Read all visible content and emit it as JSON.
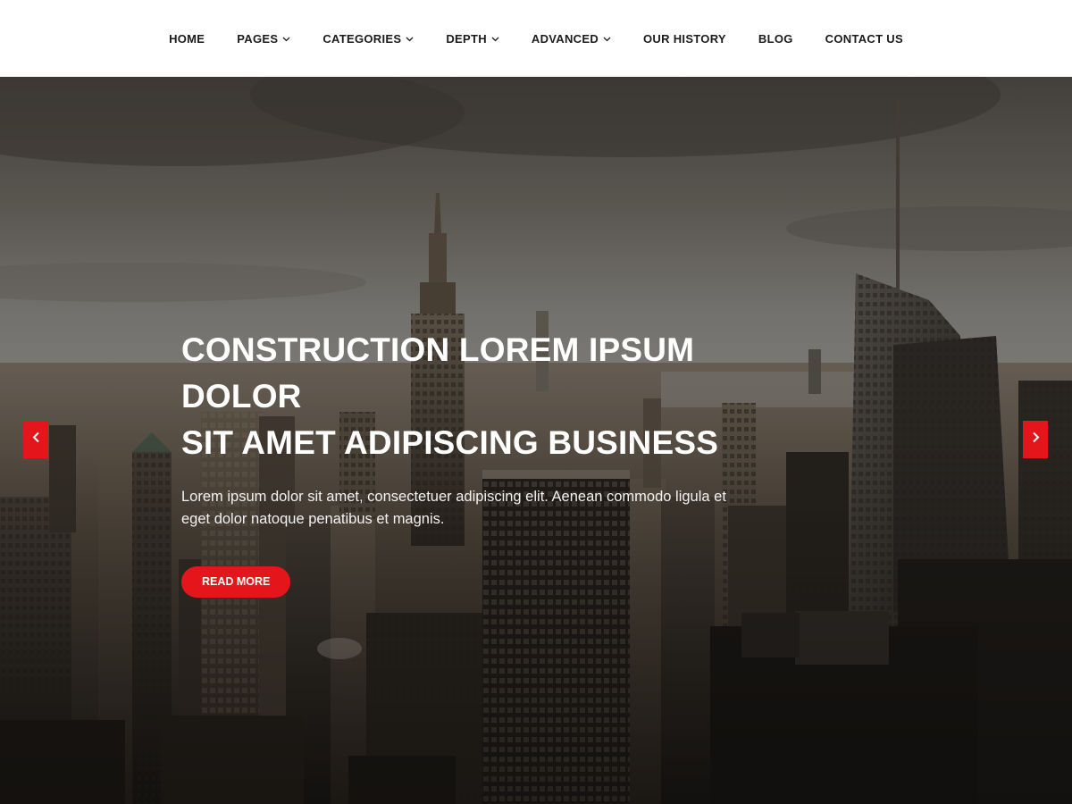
{
  "nav": {
    "items": [
      {
        "label": "HOME",
        "dropdown": false
      },
      {
        "label": "PAGES",
        "dropdown": true
      },
      {
        "label": "CATEGORIES",
        "dropdown": true
      },
      {
        "label": "DEPTH",
        "dropdown": true
      },
      {
        "label": "ADVANCED",
        "dropdown": true
      },
      {
        "label": "OUR HISTORY",
        "dropdown": false
      },
      {
        "label": "BLOG",
        "dropdown": false
      },
      {
        "label": "CONTACT US",
        "dropdown": false
      }
    ]
  },
  "hero": {
    "title_line1": "CONSTRUCTION LOREM IPSUM DOLOR",
    "title_line2": "SIT AMET ADIPISCING BUSINESS",
    "text": "Lorem ipsum dolor sit amet, consectetuer adipiscing elit. Aenean commodo ligula et eget dolor natoque penatibus et magnis.",
    "button_label": "READ MORE",
    "prev_icon": "chevron-left-icon",
    "next_icon": "chevron-right-icon"
  },
  "colors": {
    "accent": "#e5161b",
    "nav_text": "#1b1b1b",
    "header_bg": "#ffffff"
  }
}
